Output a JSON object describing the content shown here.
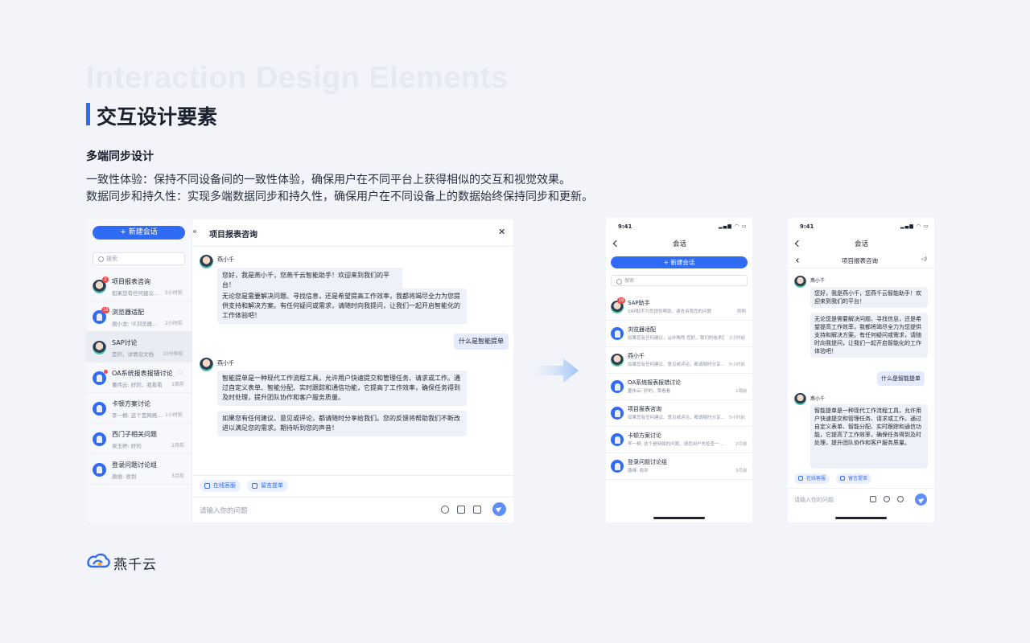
{
  "heading": {
    "bg_title": "Interaction Design Elements",
    "title": "交互设计要素",
    "subtitle": "多端同步设计",
    "desc1": "一致性体验：保持不同设备间的一致性体验，确保用户在不同平台上获得相似的交互和视觉效果。",
    "desc2": "数据同步和持久性：实现多端数据同步和持久性，确保用户在不同设备上的数据始终保持同步和更新。"
  },
  "colors": {
    "accent": "#2f6bf5",
    "badge": "#f04a4a",
    "page_bg": "#f2f4f9"
  },
  "desktop": {
    "new_chat": "+ 新建会话",
    "collapse": "«",
    "search_placeholder": "搜索",
    "chat_title": "项目报表咨询",
    "close": "✕",
    "conversations": [
      {
        "name": "项目报表咨询",
        "preview": "如果您有任何建议...",
        "time": "5小时前",
        "badge": "2",
        "avatar": "img"
      },
      {
        "name": "浏览器适配",
        "preview": "唐小龙: !E浏览器...",
        "time": "2小时前",
        "badge": "16",
        "avatar": "grp"
      },
      {
        "name": "SAP讨论",
        "preview": "是的，详情见文档",
        "time": "10分钟前",
        "badge": "",
        "avatar": "img"
      },
      {
        "name": "OA系统报表报错讨论",
        "preview": "董伟云: 好的，我看看",
        "time": "1周前",
        "badge": "",
        "avatar": "grp"
      },
      {
        "name": "卡顿方案讨论",
        "preview": "李一桐: 这个是网络...",
        "time": "1小时前",
        "badge": "",
        "avatar": "grp"
      },
      {
        "name": "西门子相关问题",
        "preview": "梁玉婷: 好的",
        "time": "2月前",
        "badge": "",
        "avatar": "grp"
      },
      {
        "name": "登录问题讨论组",
        "preview": "唐维: 收到",
        "time": "3月前",
        "badge": "",
        "avatar": "grp"
      }
    ],
    "messages": {
      "sender": "燕小千",
      "greet": "您好，我是燕小千，您燕千云智能助手！欢迎来到我们的平台！",
      "intro": "无论您是需要解决问题、寻找信息，还是希望提高工作效率，我都将竭尽全力为您提供支持和解决方案。有任何疑问或需求，请随时向我提问，让我们一起开启智能化的工作体验吧！",
      "user": "什么是智能提单",
      "answer1": "智能提单是一种现代工作流程工具，允许用户快速提交和管理任务、请求或工作。通过自定义表单、智能分配、实时跟踪和通信功能，它提高了工作效率，确保任务得到及时处理，提升团队协作和客户服务质量。",
      "answer2": "如果您有任何建议、意见或评论，都请随时分享给我们。您的反馈将帮助我们不断改进以满足您的需求。期待听到您的声音！"
    },
    "chips": [
      "在线客服",
      "留言提单"
    ],
    "input_placeholder": "请输入你的问题"
  },
  "mobile1": {
    "time": "9:41",
    "signal": "▂▄▆ ◠ ▭",
    "title": "会话",
    "new_chat": "+ 新建会话",
    "search_placeholder": "搜索",
    "conversations": [
      {
        "name": "SAP助手",
        "preview": "SAP助手为您提供帮助，请告诉我您的问题",
        "time": "刚刚",
        "badge": "18",
        "avatar": "img"
      },
      {
        "name": "浏览器适配",
        "preview": "如果您有任何建议，@孙陶然 您好，我们的技术团队...",
        "time": "2小时前",
        "badge": "",
        "avatar": "grp"
      },
      {
        "name": "燕小千",
        "preview": "如果您有任何建议、意见或评论，都请随时分享...",
        "time": "5小时前",
        "badge": "",
        "avatar": "img"
      },
      {
        "name": "OA系统报表报错讨论",
        "preview": "董伟云: 好的，我看看",
        "time": "1周前",
        "badge": "",
        "avatar": "grp"
      },
      {
        "name": "项目报表咨询",
        "preview": "如果您有任何建议、意见或评论，都请随时分享...",
        "time": "5小时前",
        "badge": "",
        "avatar": "grp"
      },
      {
        "name": "卡顿方案讨论",
        "preview": "李一桐: 这个是网络的问题，请您用户先检查一...",
        "time": "2月前",
        "badge": "",
        "avatar": "grp"
      },
      {
        "name": "登录问题讨论组",
        "preview": "唐维: 收到",
        "time": "3月前",
        "badge": "",
        "avatar": "grp"
      }
    ]
  },
  "mobile2": {
    "time": "9:41",
    "signal": "▂▄▆ ◠ ▭",
    "title": "会话",
    "chat_title": "项目报表咨询",
    "sender": "燕小千",
    "greet": "您好，我是燕小千，您燕千云智能助手！欢迎来到我们的平台！",
    "intro": "无论您是需要解决问题、寻找信息，还是希望提高工作效率，我都将竭尽全力为您提供支持和解决方案。有任何疑问或需求，请随时向我提问，让我们一起开启智能化的工作体验吧！",
    "user": "什么是智能提单",
    "answer": "智能提单是一种现代工作流程工具，允许用户快速提交和管理任务、请求或工作。通过自定义表单、智能分配、实时跟踪和通信功能，它提高了工作效率，确保任务得到及时处理，提升团队协作和客户服务质量。",
    "chips": [
      "在线客服",
      "留言提单"
    ],
    "input_placeholder": "请输入你的问题",
    "voice": "◁)"
  },
  "brand": {
    "name": "燕千云"
  }
}
